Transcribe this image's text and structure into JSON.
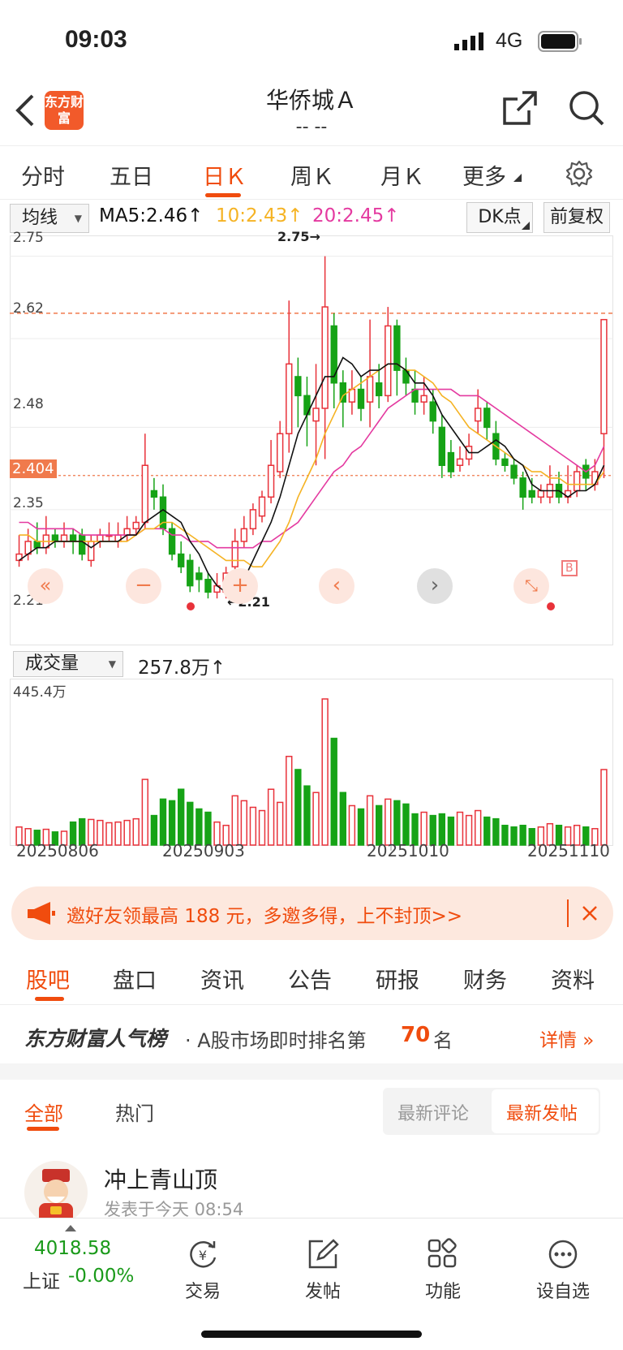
{
  "status": {
    "time": "09:03",
    "network": "4G"
  },
  "header": {
    "logo": "东方财富",
    "title": "华侨城Ａ",
    "subtitle": "-- --"
  },
  "tabs": [
    "分时",
    "五日",
    "日Ｋ",
    "周Ｋ",
    "月Ｋ",
    "更多"
  ],
  "active_tab": "日Ｋ",
  "indicator": {
    "ma_select": "均线",
    "ma5": "MA5:2.46↑",
    "ma10": "10:2.43↑",
    "ma20": "20:2.45↑",
    "dk_label": "DK点",
    "adjust_label": "前复权"
  },
  "colors": {
    "accent": "#f04c0e",
    "up": "#e8323a",
    "down": "#16a316",
    "ma5": "#111111",
    "ma10": "#f5b324",
    "ma20": "#e43aa0"
  },
  "kline": {
    "y_labels": [
      "2.75",
      "2.62",
      "2.48",
      "2.35",
      "2.21"
    ],
    "current_label": "2.404",
    "high_label": "2.75→",
    "low_label": "←2.21",
    "signal_label": "B"
  },
  "volume": {
    "select": "成交量",
    "value": "257.8万↑",
    "max_label": "445.4万",
    "dates": [
      "20250806",
      "20250903",
      "20251010",
      "20251110"
    ]
  },
  "chart_data": {
    "type": "candlestick",
    "ylim": [
      2.2,
      2.77
    ],
    "bars": [
      {
        "o": 2.27,
        "c": 2.28,
        "h": 2.31,
        "l": 2.26,
        "v": 55
      },
      {
        "o": 2.28,
        "c": 2.3,
        "h": 2.32,
        "l": 2.27,
        "v": 50
      },
      {
        "o": 2.3,
        "c": 2.29,
        "h": 2.33,
        "l": 2.28,
        "v": 45
      },
      {
        "o": 2.29,
        "c": 2.31,
        "h": 2.34,
        "l": 2.28,
        "v": 48
      },
      {
        "o": 2.31,
        "c": 2.3,
        "h": 2.32,
        "l": 2.29,
        "v": 40
      },
      {
        "o": 2.3,
        "c": 2.31,
        "h": 2.33,
        "l": 2.29,
        "v": 42
      },
      {
        "o": 2.31,
        "c": 2.3,
        "h": 2.32,
        "l": 2.28,
        "v": 70
      },
      {
        "o": 2.31,
        "c": 2.28,
        "h": 2.32,
        "l": 2.27,
        "v": 80
      },
      {
        "o": 2.27,
        "c": 2.3,
        "h": 2.31,
        "l": 2.26,
        "v": 78
      },
      {
        "o": 2.3,
        "c": 2.31,
        "h": 2.32,
        "l": 2.29,
        "v": 75
      },
      {
        "o": 2.31,
        "c": 2.31,
        "h": 2.33,
        "l": 2.3,
        "v": 68
      },
      {
        "o": 2.3,
        "c": 2.31,
        "h": 2.33,
        "l": 2.29,
        "v": 70
      },
      {
        "o": 2.31,
        "c": 2.32,
        "h": 2.34,
        "l": 2.3,
        "v": 75
      },
      {
        "o": 2.32,
        "c": 2.33,
        "h": 2.34,
        "l": 2.31,
        "v": 80
      },
      {
        "o": 2.33,
        "c": 2.42,
        "h": 2.47,
        "l": 2.32,
        "v": 200
      },
      {
        "o": 2.38,
        "c": 2.37,
        "h": 2.4,
        "l": 2.35,
        "v": 90
      },
      {
        "o": 2.37,
        "c": 2.32,
        "h": 2.39,
        "l": 2.31,
        "v": 140
      },
      {
        "o": 2.32,
        "c": 2.28,
        "h": 2.33,
        "l": 2.27,
        "v": 135
      },
      {
        "o": 2.28,
        "c": 2.26,
        "h": 2.3,
        "l": 2.25,
        "v": 170
      },
      {
        "o": 2.27,
        "c": 2.23,
        "h": 2.28,
        "l": 2.22,
        "v": 130
      },
      {
        "o": 2.25,
        "c": 2.24,
        "h": 2.26,
        "l": 2.22,
        "v": 110
      },
      {
        "o": 2.24,
        "c": 2.22,
        "h": 2.25,
        "l": 2.21,
        "v": 100
      },
      {
        "o": 2.22,
        "c": 2.23,
        "h": 2.25,
        "l": 2.21,
        "v": 70
      },
      {
        "o": 2.22,
        "c": 2.25,
        "h": 2.26,
        "l": 2.21,
        "v": 60
      },
      {
        "o": 2.26,
        "c": 2.3,
        "h": 2.32,
        "l": 2.25,
        "v": 150
      },
      {
        "o": 2.3,
        "c": 2.32,
        "h": 2.34,
        "l": 2.29,
        "v": 135
      },
      {
        "o": 2.32,
        "c": 2.35,
        "h": 2.36,
        "l": 2.31,
        "v": 115
      },
      {
        "o": 2.34,
        "c": 2.37,
        "h": 2.38,
        "l": 2.33,
        "v": 105
      },
      {
        "o": 2.37,
        "c": 2.42,
        "h": 2.46,
        "l": 2.36,
        "v": 170
      },
      {
        "o": 2.41,
        "c": 2.47,
        "h": 2.49,
        "l": 2.4,
        "v": 130
      },
      {
        "o": 2.47,
        "c": 2.58,
        "h": 2.68,
        "l": 2.44,
        "v": 270
      },
      {
        "o": 2.56,
        "c": 2.53,
        "h": 2.59,
        "l": 2.48,
        "v": 230
      },
      {
        "o": 2.53,
        "c": 2.5,
        "h": 2.56,
        "l": 2.45,
        "v": 180
      },
      {
        "o": 2.49,
        "c": 2.51,
        "h": 2.58,
        "l": 2.42,
        "v": 160
      },
      {
        "o": 2.51,
        "c": 2.67,
        "h": 2.75,
        "l": 2.43,
        "v": 445
      },
      {
        "o": 2.64,
        "c": 2.55,
        "h": 2.66,
        "l": 2.51,
        "v": 325
      },
      {
        "o": 2.55,
        "c": 2.52,
        "h": 2.57,
        "l": 2.48,
        "v": 160
      },
      {
        "o": 2.52,
        "c": 2.54,
        "h": 2.57,
        "l": 2.5,
        "v": 120
      },
      {
        "o": 2.54,
        "c": 2.51,
        "h": 2.56,
        "l": 2.49,
        "v": 110
      },
      {
        "o": 2.52,
        "c": 2.56,
        "h": 2.65,
        "l": 2.48,
        "v": 150
      },
      {
        "o": 2.55,
        "c": 2.53,
        "h": 2.58,
        "l": 2.51,
        "v": 120
      },
      {
        "o": 2.53,
        "c": 2.64,
        "h": 2.67,
        "l": 2.52,
        "v": 140
      },
      {
        "o": 2.64,
        "c": 2.57,
        "h": 2.65,
        "l": 2.53,
        "v": 135
      },
      {
        "o": 2.57,
        "c": 2.55,
        "h": 2.59,
        "l": 2.53,
        "v": 125
      },
      {
        "o": 2.54,
        "c": 2.52,
        "h": 2.57,
        "l": 2.5,
        "v": 95
      },
      {
        "o": 2.52,
        "c": 2.53,
        "h": 2.56,
        "l": 2.5,
        "v": 100
      },
      {
        "o": 2.52,
        "c": 2.49,
        "h": 2.54,
        "l": 2.47,
        "v": 90
      },
      {
        "o": 2.48,
        "c": 2.42,
        "h": 2.5,
        "l": 2.4,
        "v": 95
      },
      {
        "o": 2.44,
        "c": 2.41,
        "h": 2.46,
        "l": 2.4,
        "v": 85
      },
      {
        "o": 2.42,
        "c": 2.43,
        "h": 2.45,
        "l": 2.41,
        "v": 100
      },
      {
        "o": 2.43,
        "c": 2.45,
        "h": 2.47,
        "l": 2.42,
        "v": 90
      },
      {
        "o": 2.49,
        "c": 2.51,
        "h": 2.54,
        "l": 2.47,
        "v": 105
      },
      {
        "o": 2.51,
        "c": 2.48,
        "h": 2.52,
        "l": 2.46,
        "v": 85
      },
      {
        "o": 2.47,
        "c": 2.43,
        "h": 2.49,
        "l": 2.42,
        "v": 80
      },
      {
        "o": 2.43,
        "c": 2.42,
        "h": 2.44,
        "l": 2.41,
        "v": 60
      },
      {
        "o": 2.42,
        "c": 2.4,
        "h": 2.43,
        "l": 2.39,
        "v": 55
      },
      {
        "o": 2.4,
        "c": 2.37,
        "h": 2.41,
        "l": 2.35,
        "v": 60
      },
      {
        "o": 2.38,
        "c": 2.37,
        "h": 2.4,
        "l": 2.36,
        "v": 50
      },
      {
        "o": 2.37,
        "c": 2.38,
        "h": 2.39,
        "l": 2.36,
        "v": 55
      },
      {
        "o": 2.37,
        "c": 2.39,
        "h": 2.42,
        "l": 2.36,
        "v": 65
      },
      {
        "o": 2.39,
        "c": 2.37,
        "h": 2.41,
        "l": 2.36,
        "v": 60
      },
      {
        "o": 2.37,
        "c": 2.38,
        "h": 2.42,
        "l": 2.36,
        "v": 55
      },
      {
        "o": 2.38,
        "c": 2.41,
        "h": 2.42,
        "l": 2.37,
        "v": 60
      },
      {
        "o": 2.42,
        "c": 2.4,
        "h": 2.43,
        "l": 2.38,
        "v": 55
      },
      {
        "o": 2.39,
        "c": 2.41,
        "h": 2.43,
        "l": 2.38,
        "v": 50
      },
      {
        "o": 2.47,
        "c": 2.65,
        "h": 2.65,
        "l": 2.4,
        "v": 230
      }
    ],
    "ma5": [
      2.27,
      2.28,
      2.29,
      2.29,
      2.3,
      2.3,
      2.3,
      2.3,
      2.29,
      2.3,
      2.3,
      2.3,
      2.31,
      2.31,
      2.33,
      2.34,
      2.35,
      2.34,
      2.33,
      2.3,
      2.28,
      2.25,
      2.23,
      2.22,
      2.23,
      2.24,
      2.27,
      2.3,
      2.33,
      2.37,
      2.42,
      2.47,
      2.5,
      2.53,
      2.56,
      2.56,
      2.59,
      2.58,
      2.56,
      2.57,
      2.57,
      2.58,
      2.58,
      2.57,
      2.55,
      2.55,
      2.53,
      2.5,
      2.48,
      2.46,
      2.44,
      2.44,
      2.45,
      2.46,
      2.45,
      2.43,
      2.42,
      2.39,
      2.38,
      2.38,
      2.38,
      2.37,
      2.38,
      2.38,
      2.39,
      2.42
    ],
    "ma10": [
      2.31,
      2.31,
      2.3,
      2.3,
      2.3,
      2.3,
      2.3,
      2.3,
      2.3,
      2.3,
      2.3,
      2.3,
      2.3,
      2.31,
      2.32,
      2.32,
      2.33,
      2.33,
      2.32,
      2.31,
      2.3,
      2.29,
      2.28,
      2.27,
      2.27,
      2.27,
      2.26,
      2.26,
      2.28,
      2.3,
      2.33,
      2.37,
      2.4,
      2.43,
      2.47,
      2.5,
      2.53,
      2.54,
      2.55,
      2.56,
      2.57,
      2.58,
      2.58,
      2.57,
      2.57,
      2.56,
      2.55,
      2.53,
      2.52,
      2.5,
      2.48,
      2.47,
      2.46,
      2.45,
      2.44,
      2.43,
      2.42,
      2.41,
      2.41,
      2.4,
      2.4,
      2.39,
      2.39,
      2.39,
      2.39,
      2.41
    ],
    "ma20": [
      2.33,
      2.33,
      2.32,
      2.32,
      2.32,
      2.32,
      2.32,
      2.31,
      2.31,
      2.31,
      2.31,
      2.31,
      2.31,
      2.31,
      2.32,
      2.32,
      2.32,
      2.31,
      2.31,
      2.3,
      2.3,
      2.3,
      2.29,
      2.29,
      2.29,
      2.29,
      2.29,
      2.3,
      2.3,
      2.31,
      2.32,
      2.33,
      2.35,
      2.37,
      2.39,
      2.41,
      2.42,
      2.44,
      2.45,
      2.47,
      2.49,
      2.51,
      2.52,
      2.53,
      2.54,
      2.54,
      2.54,
      2.54,
      2.54,
      2.53,
      2.53,
      2.53,
      2.52,
      2.51,
      2.5,
      2.49,
      2.48,
      2.47,
      2.46,
      2.45,
      2.44,
      2.43,
      2.42,
      2.41,
      2.42,
      2.45
    ]
  },
  "banner": {
    "text": "邀好友领最高 188 元，多邀多得，上不封顶>>"
  },
  "section_tabs": [
    "股吧",
    "盘口",
    "资讯",
    "公告",
    "研报",
    "财务",
    "资料"
  ],
  "rank": {
    "brand": "东方财富人气榜",
    "prefix": "· A股市场即时排名第",
    "number": "70",
    "suffix": "名",
    "detail": "详情 »"
  },
  "posts": {
    "filters": [
      "全部",
      "热门"
    ],
    "sort": [
      "最新评论",
      "最新发帖"
    ],
    "post": {
      "author": "冲上青山顶",
      "time": "发表于今天 08:54"
    }
  },
  "bottom": {
    "index_value": "4018.58",
    "index_name": "上证",
    "index_change": "-0.00%",
    "nav": [
      "交易",
      "发帖",
      "功能",
      "设自选"
    ]
  }
}
